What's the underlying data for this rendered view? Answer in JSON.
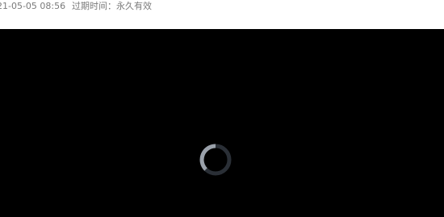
{
  "meta": {
    "upload_date": "21-05-05 08:56",
    "expiry": "过期时间：永久有效"
  },
  "player": {
    "state": "loading",
    "spinner_icon": "loading-spinner-icon",
    "colors": {
      "background": "#000000",
      "spinner_track": "#2a2f36",
      "spinner_arc": "#9aa1aa"
    }
  }
}
